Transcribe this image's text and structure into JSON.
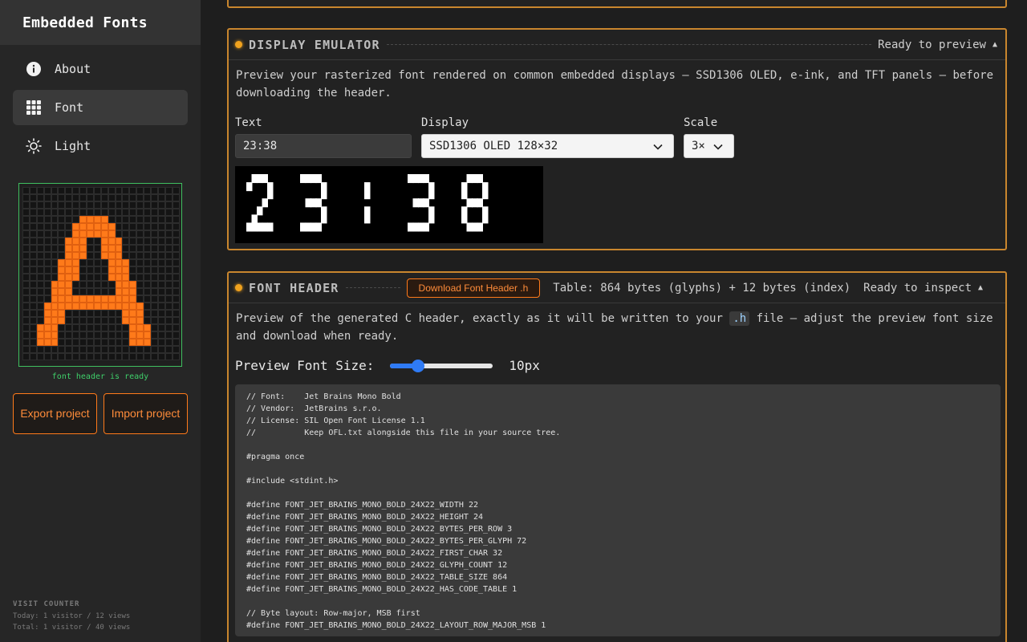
{
  "app": {
    "title": "Embedded Fonts"
  },
  "sidebar": {
    "items": [
      {
        "label": "About",
        "icon": "info-icon"
      },
      {
        "label": "Font",
        "icon": "grid-icon"
      },
      {
        "label": "Light",
        "icon": "sun-icon"
      }
    ],
    "preview_glyph": "A",
    "status": "font header is ready",
    "export_label": "Export project",
    "import_label": "Import project",
    "visit_counter": {
      "heading": "VISIT COUNTER",
      "today": "Today: 1 visitor / 12 views",
      "total": "Total: 1 visitor / 40 views"
    }
  },
  "display_emulator": {
    "title": "DISPLAY EMULATOR",
    "status": "Ready to preview",
    "description": "Preview your rasterized font rendered on common embedded displays — SSD1306 OLED, e-ink, and TFT panels — before downloading the header.",
    "text_label": "Text",
    "text_value": "23:38",
    "display_label": "Display",
    "display_value": "SSD1306 OLED 128×32",
    "scale_label": "Scale",
    "scale_value": "3×",
    "screen_text": "23:38"
  },
  "font_header": {
    "title": "FONT HEADER",
    "download_label": "Download Font Header .h",
    "table_info": "Table: 864 bytes (glyphs) + 12 bytes (index)",
    "status": "Ready to inspect",
    "description_pre": "Preview of the generated C header, exactly as it will be written to your",
    "description_code": ".h",
    "description_post": "file — adjust the preview font size and download when ready.",
    "preview_font_size_label": "Preview Font Size:",
    "preview_font_size_value": "10px",
    "preview_font_size_fraction": 0.27,
    "code": "// Font:    Jet Brains Mono Bold\n// Vendor:  JetBrains s.r.o.\n// License: SIL Open Font License 1.1\n//          Keep OFL.txt alongside this file in your source tree.\n\n#pragma once\n\n#include <stdint.h>\n\n#define FONT_JET_BRAINS_MONO_BOLD_24X22_WIDTH 22\n#define FONT_JET_BRAINS_MONO_BOLD_24X22_HEIGHT 24\n#define FONT_JET_BRAINS_MONO_BOLD_24X22_BYTES_PER_ROW 3\n#define FONT_JET_BRAINS_MONO_BOLD_24X22_BYTES_PER_GLYPH 72\n#define FONT_JET_BRAINS_MONO_BOLD_24X22_FIRST_CHAR 32\n#define FONT_JET_BRAINS_MONO_BOLD_24X22_GLYPH_COUNT 12\n#define FONT_JET_BRAINS_MONO_BOLD_24X22_TABLE_SIZE 864\n#define FONT_JET_BRAINS_MONO_BOLD_24X22_HAS_CODE_TABLE 1\n\n// Byte layout: Row-major, MSB first\n#define FONT_JET_BRAINS_MONO_BOLD_24X22_LAYOUT_ROW_MAJOR_MSB 1"
  },
  "colors": {
    "accent": "#ff7a1a",
    "panel_border": "#c9862e",
    "ready_green": "#3fcf6a",
    "slider_blue": "#2f7bf5"
  }
}
